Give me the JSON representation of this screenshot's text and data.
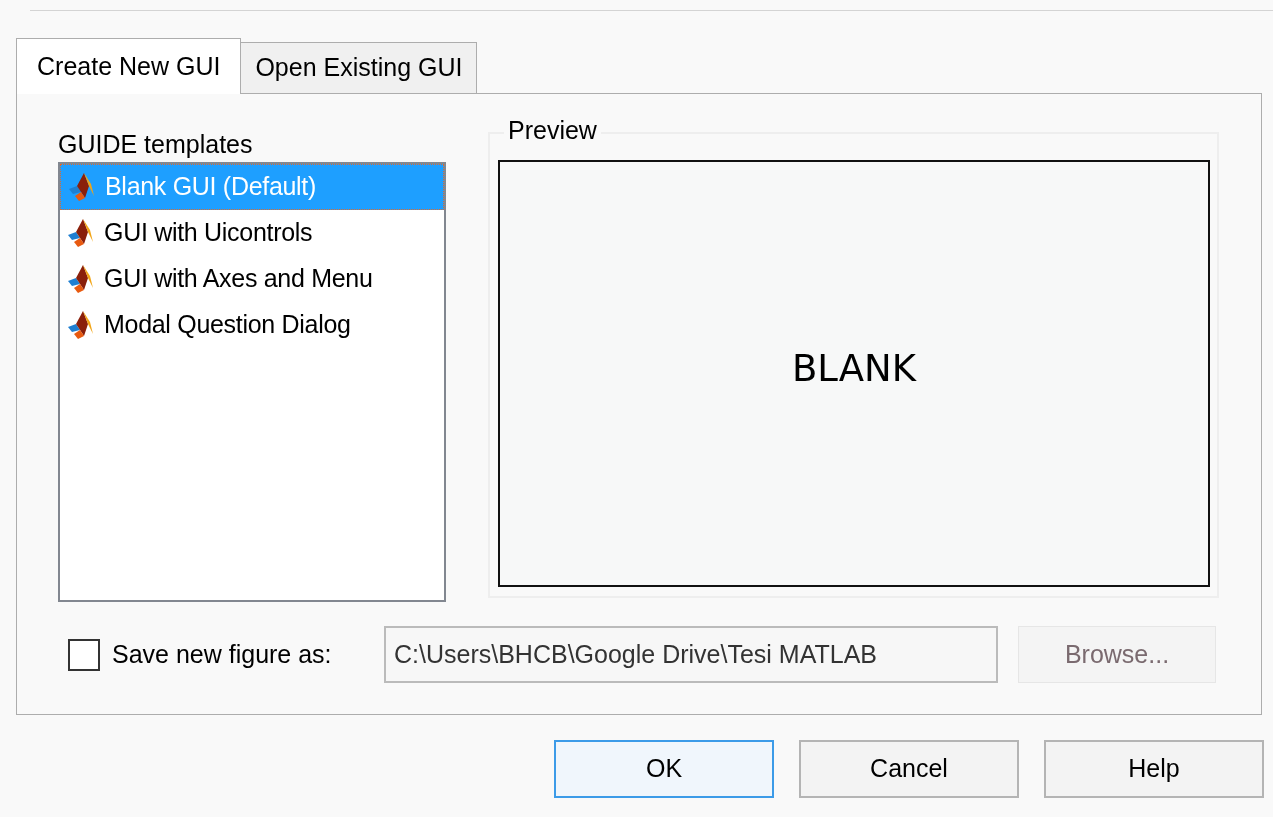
{
  "tabs": [
    {
      "label": "Create New GUI",
      "selected": true
    },
    {
      "label": "Open Existing GUI",
      "selected": false
    }
  ],
  "templates": {
    "label": "GUIDE templates",
    "items": [
      {
        "label": "Blank GUI (Default)",
        "selected": true
      },
      {
        "label": "GUI with Uicontrols",
        "selected": false
      },
      {
        "label": "GUI with Axes and Menu",
        "selected": false
      },
      {
        "label": "Modal Question Dialog",
        "selected": false
      }
    ]
  },
  "preview": {
    "label": "Preview",
    "text": "BLANK"
  },
  "save": {
    "label": "Save new figure as:",
    "checked": false,
    "value": "C:\\Users\\BHCB\\Google Drive\\Tesi MATLAB"
  },
  "browse": {
    "label": "Browse...",
    "disabled": true
  },
  "buttons": [
    {
      "label": "OK",
      "default": true
    },
    {
      "label": "Cancel",
      "default": false
    },
    {
      "label": "Help",
      "default": false
    }
  ]
}
